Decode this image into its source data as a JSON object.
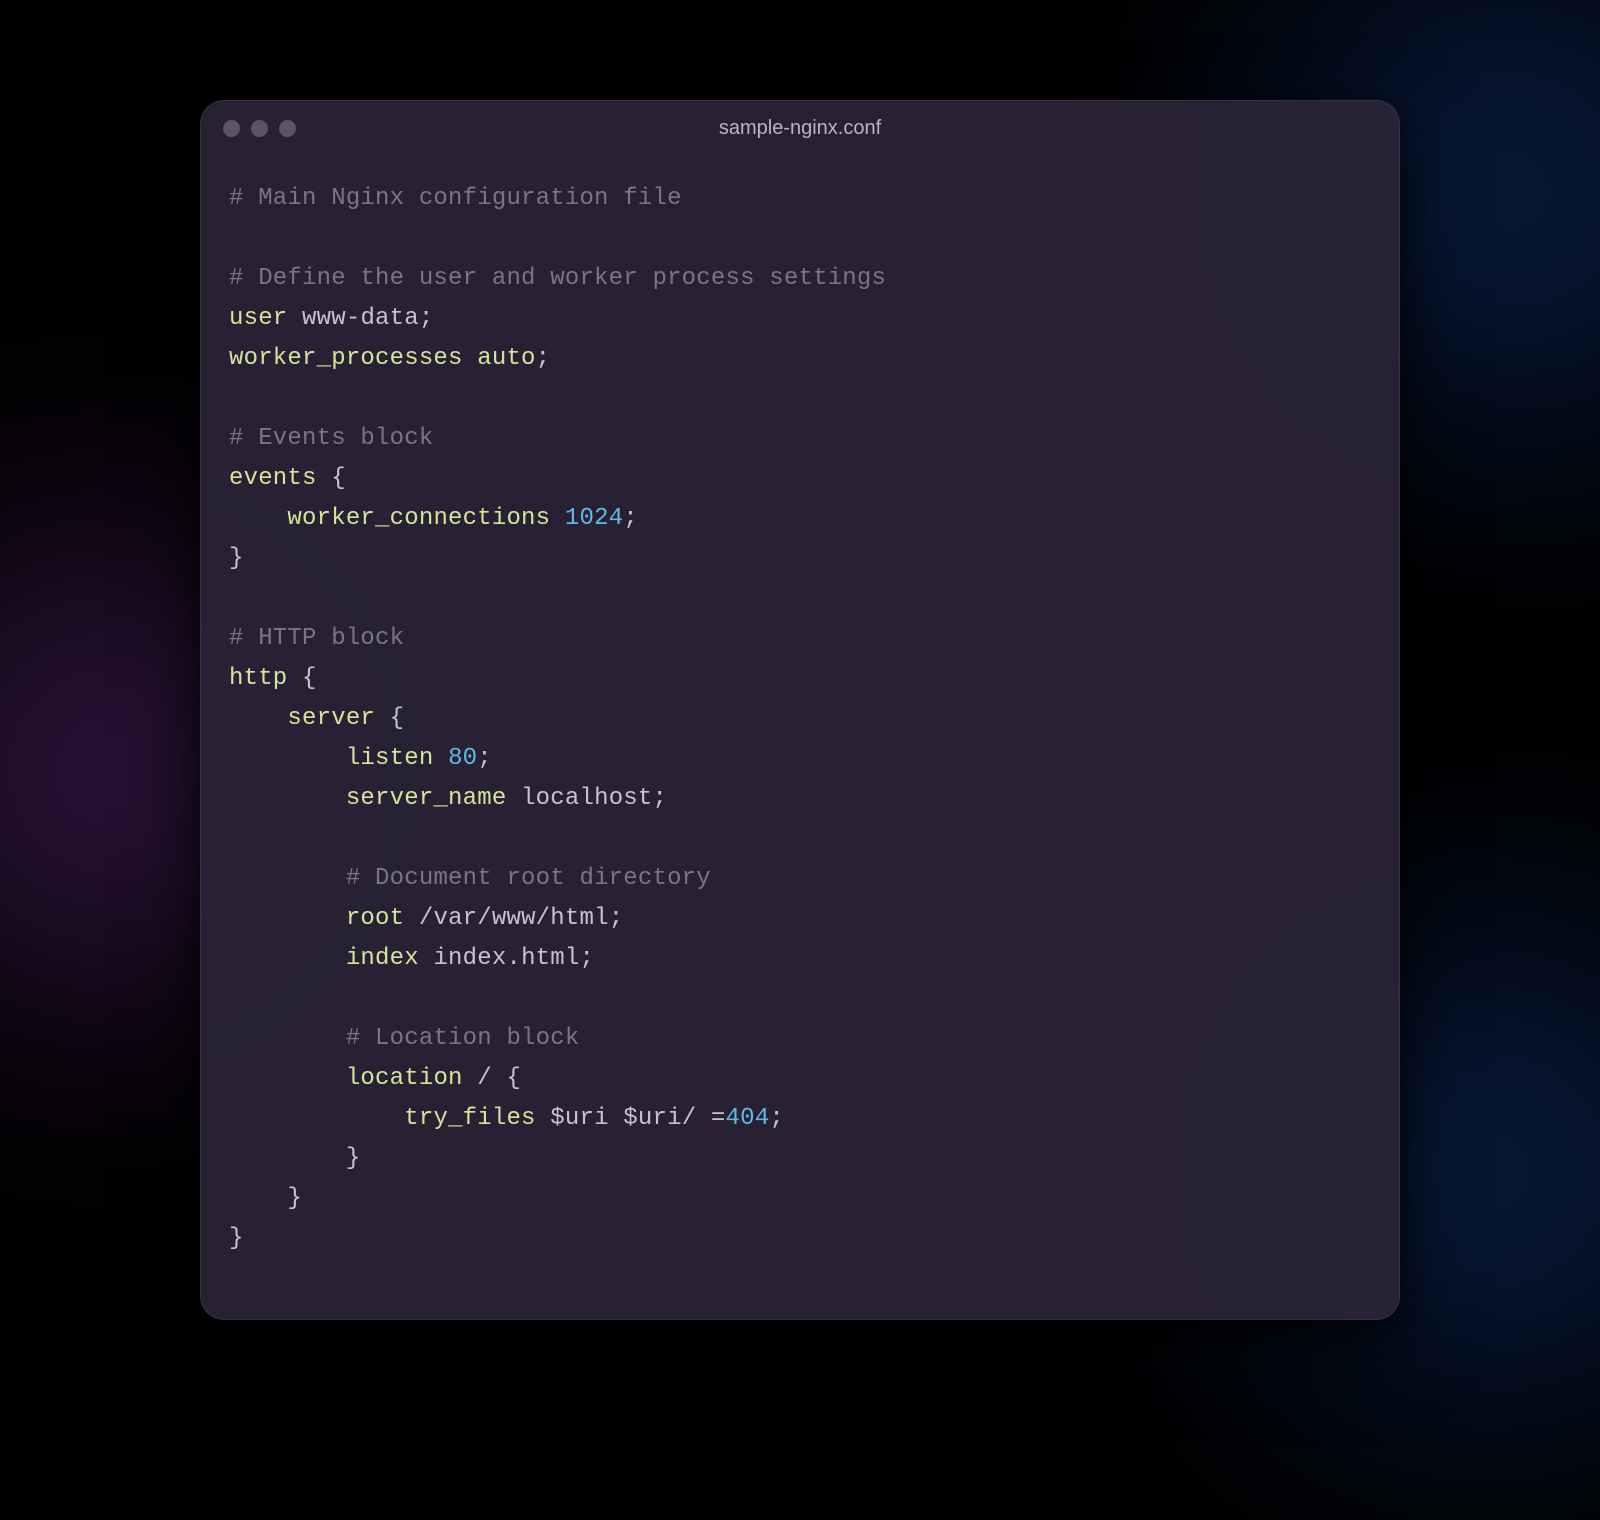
{
  "window": {
    "title": "sample-nginx.conf"
  },
  "code": {
    "tokens": [
      [
        {
          "c": "comment",
          "t": "# Main Nginx configuration file"
        }
      ],
      [],
      [
        {
          "c": "comment",
          "t": "# Define the user and worker process settings"
        }
      ],
      [
        {
          "c": "directive",
          "t": "user"
        },
        {
          "c": "punc",
          "t": " "
        },
        {
          "c": "value",
          "t": "www-data"
        },
        {
          "c": "punc",
          "t": ";"
        }
      ],
      [
        {
          "c": "directive",
          "t": "worker_processes"
        },
        {
          "c": "punc",
          "t": " "
        },
        {
          "c": "directive",
          "t": "auto"
        },
        {
          "c": "punc",
          "t": ";"
        }
      ],
      [],
      [
        {
          "c": "comment",
          "t": "# Events block"
        }
      ],
      [
        {
          "c": "directive",
          "t": "events"
        },
        {
          "c": "punc",
          "t": " "
        },
        {
          "c": "brace",
          "t": "{"
        }
      ],
      [
        {
          "c": "punc",
          "t": "    "
        },
        {
          "c": "directive",
          "t": "worker_connections"
        },
        {
          "c": "punc",
          "t": " "
        },
        {
          "c": "number",
          "t": "1024"
        },
        {
          "c": "punc",
          "t": ";"
        }
      ],
      [
        {
          "c": "brace",
          "t": "}"
        }
      ],
      [],
      [
        {
          "c": "comment",
          "t": "# HTTP block"
        }
      ],
      [
        {
          "c": "directive",
          "t": "http"
        },
        {
          "c": "punc",
          "t": " "
        },
        {
          "c": "brace",
          "t": "{"
        }
      ],
      [
        {
          "c": "punc",
          "t": "    "
        },
        {
          "c": "directive",
          "t": "server"
        },
        {
          "c": "punc",
          "t": " "
        },
        {
          "c": "brace",
          "t": "{"
        }
      ],
      [
        {
          "c": "punc",
          "t": "        "
        },
        {
          "c": "directive",
          "t": "listen"
        },
        {
          "c": "punc",
          "t": " "
        },
        {
          "c": "number",
          "t": "80"
        },
        {
          "c": "punc",
          "t": ";"
        }
      ],
      [
        {
          "c": "punc",
          "t": "        "
        },
        {
          "c": "directive",
          "t": "server_name"
        },
        {
          "c": "punc",
          "t": " "
        },
        {
          "c": "value",
          "t": "localhost"
        },
        {
          "c": "punc",
          "t": ";"
        }
      ],
      [],
      [
        {
          "c": "punc",
          "t": "        "
        },
        {
          "c": "comment",
          "t": "# Document root directory"
        }
      ],
      [
        {
          "c": "punc",
          "t": "        "
        },
        {
          "c": "directive",
          "t": "root"
        },
        {
          "c": "punc",
          "t": " "
        },
        {
          "c": "value",
          "t": "/var/www/html"
        },
        {
          "c": "punc",
          "t": ";"
        }
      ],
      [
        {
          "c": "punc",
          "t": "        "
        },
        {
          "c": "directive",
          "t": "index"
        },
        {
          "c": "punc",
          "t": " "
        },
        {
          "c": "value",
          "t": "index.html"
        },
        {
          "c": "punc",
          "t": ";"
        }
      ],
      [],
      [
        {
          "c": "punc",
          "t": "        "
        },
        {
          "c": "comment",
          "t": "# Location block"
        }
      ],
      [
        {
          "c": "punc",
          "t": "        "
        },
        {
          "c": "directive",
          "t": "location"
        },
        {
          "c": "punc",
          "t": " "
        },
        {
          "c": "value",
          "t": "/"
        },
        {
          "c": "punc",
          "t": " "
        },
        {
          "c": "brace",
          "t": "{"
        }
      ],
      [
        {
          "c": "punc",
          "t": "            "
        },
        {
          "c": "directive",
          "t": "try_files"
        },
        {
          "c": "punc",
          "t": " "
        },
        {
          "c": "var",
          "t": "$uri"
        },
        {
          "c": "punc",
          "t": " "
        },
        {
          "c": "var",
          "t": "$uri/"
        },
        {
          "c": "punc",
          "t": " "
        },
        {
          "c": "value",
          "t": "="
        },
        {
          "c": "number",
          "t": "404"
        },
        {
          "c": "punc",
          "t": ";"
        }
      ],
      [
        {
          "c": "punc",
          "t": "        "
        },
        {
          "c": "brace",
          "t": "}"
        }
      ],
      [
        {
          "c": "punc",
          "t": "    "
        },
        {
          "c": "brace",
          "t": "}"
        }
      ],
      [
        {
          "c": "brace",
          "t": "}"
        }
      ]
    ]
  }
}
